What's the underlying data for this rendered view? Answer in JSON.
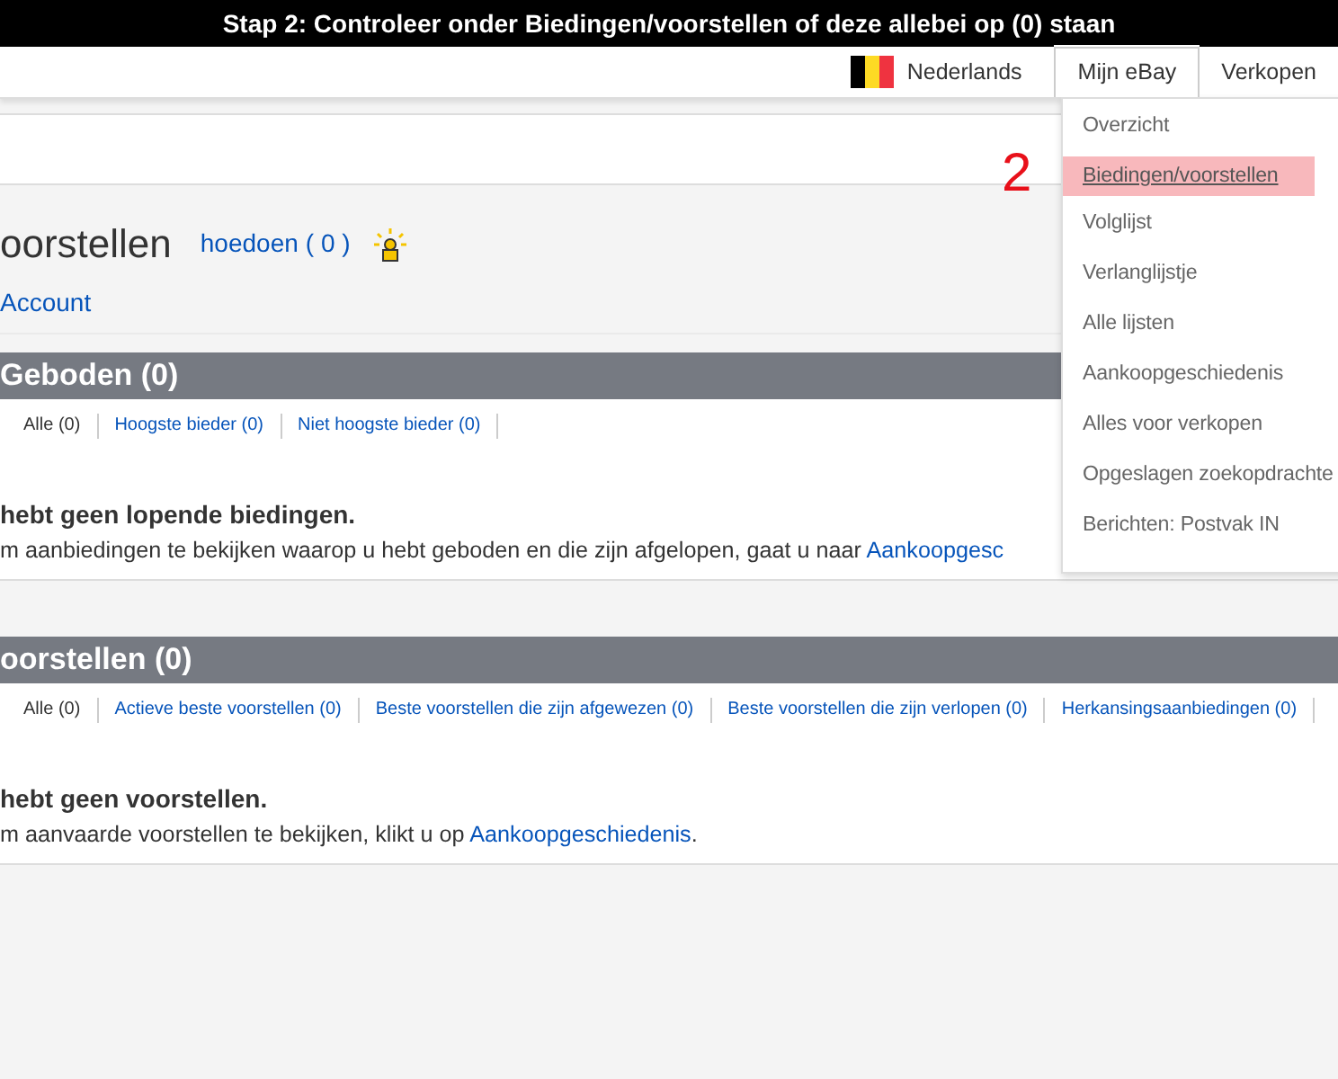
{
  "caption": "Stap 2: Controleer onder Biedingen/voorstellen of deze allebei op (0) staan",
  "header": {
    "language": "Nederlands",
    "tabs": [
      {
        "label": "Mijn eBay",
        "selected": true
      },
      {
        "label": "Verkopen",
        "selected": false
      }
    ]
  },
  "page_title": "oorstellen",
  "help_link": "hoedoen",
  "help_count": "( 0 )",
  "account_link": "Account",
  "sections": [
    {
      "title": "Geboden (0)",
      "filters": [
        {
          "label": "Alle (0)",
          "selected": true
        },
        {
          "label": "Hoogste bieder (0)",
          "selected": false
        },
        {
          "label": "Niet hoogste bieder (0)",
          "selected": false
        }
      ],
      "message": "hebt geen lopende biedingen.",
      "detail": "m aanbiedingen te bekijken waarop u hebt geboden en die zijn afgelopen, gaat u naar ",
      "link": "Aankoopgesc"
    },
    {
      "title": "oorstellen (0)",
      "filters": [
        {
          "label": "Alle (0)",
          "selected": true
        },
        {
          "label": "Actieve beste voorstellen (0)",
          "selected": false
        },
        {
          "label": "Beste voorstellen die zijn afgewezen (0)",
          "selected": false
        },
        {
          "label": "Beste voorstellen die zijn verlopen (0)",
          "selected": false
        },
        {
          "label": "Herkansingsaanbiedingen (0)",
          "selected": false
        }
      ],
      "message": "hebt geen voorstellen.",
      "detail": "m aanvaarde voorstellen te bekijken, klikt u op ",
      "link": "Aankoopgeschiedenis",
      "after": "."
    }
  ],
  "menu": [
    {
      "label": "Overzicht",
      "selected": false
    },
    {
      "label": "Biedingen/voorstellen",
      "selected": true
    },
    {
      "label": "Volglijst",
      "selected": false
    },
    {
      "label": "Verlanglijstje",
      "selected": false
    },
    {
      "label": "Alle lijsten",
      "selected": false
    },
    {
      "label": "Aankoopgeschiedenis",
      "selected": false
    },
    {
      "label": "Alles voor verkopen",
      "selected": false
    },
    {
      "label": "Opgeslagen zoekopdrachte",
      "selected": false
    },
    {
      "label": "Berichten: Postvak IN",
      "selected": false
    }
  ],
  "annotation": "2"
}
